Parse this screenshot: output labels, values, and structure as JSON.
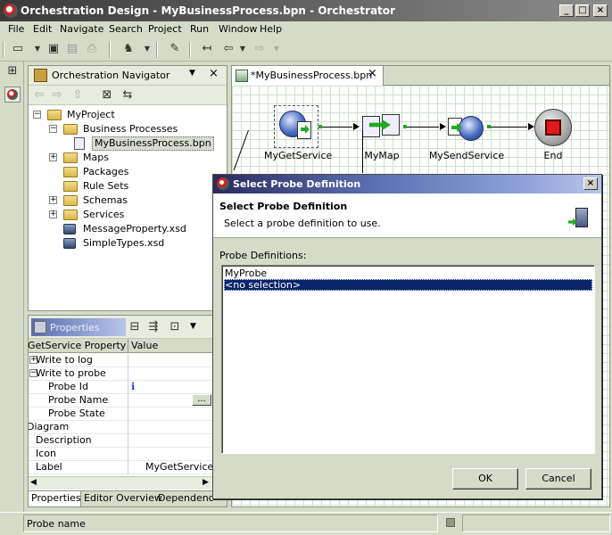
{
  "window": {
    "title": "Orchestration Design - MyBusinessProcess.bpn - Orchestrator",
    "min_glyph": "_",
    "max_glyph": "□",
    "close_glyph": "×"
  },
  "menu": [
    "File",
    "Edit",
    "Navigate",
    "Search",
    "Project",
    "Run",
    "Window",
    "Help"
  ],
  "navigator": {
    "title": "Orchestration Navigator",
    "tree": [
      {
        "label": "MyProject",
        "level": 0,
        "expander": "−",
        "icon": "folder"
      },
      {
        "label": "Business Processes",
        "level": 1,
        "expander": "−",
        "icon": "folder"
      },
      {
        "label": "MyBusinessProcess.bpn",
        "level": 2,
        "expander": "",
        "icon": "bpn-file",
        "selected": true
      },
      {
        "label": "Maps",
        "level": 1,
        "expander": "+",
        "icon": "folder"
      },
      {
        "label": "Packages",
        "level": 1,
        "expander": "",
        "icon": "folder"
      },
      {
        "label": "Rule Sets",
        "level": 1,
        "expander": "",
        "icon": "folder"
      },
      {
        "label": "Schemas",
        "level": 1,
        "expander": "+",
        "icon": "folder"
      },
      {
        "label": "Services",
        "level": 1,
        "expander": "+",
        "icon": "folder"
      },
      {
        "label": "MessageProperty.xsd",
        "level": 1,
        "expander": "",
        "icon": "xsd-file"
      },
      {
        "label": "SimpleTypes.xsd",
        "level": 1,
        "expander": "",
        "icon": "xsd-file"
      }
    ]
  },
  "properties": {
    "title": "Properties",
    "col_property": "GetService Property",
    "col_value": "Value",
    "rows": [
      {
        "key": "Write to log",
        "value": "",
        "indent": 1,
        "expander": "+"
      },
      {
        "key": "Write to probe",
        "value": "",
        "indent": 1,
        "expander": "−"
      },
      {
        "key": "Probe Id",
        "value": "ℹ",
        "indent": 2,
        "expander": ""
      },
      {
        "key": "Probe Name",
        "value": "",
        "indent": 2,
        "expander": "",
        "has_button": true
      },
      {
        "key": "Probe State",
        "value": "",
        "indent": 2,
        "expander": ""
      },
      {
        "key": "Diagram",
        "value": "",
        "indent": 0,
        "expander": ""
      },
      {
        "key": "Description",
        "value": "",
        "indent": 1,
        "expander": ""
      },
      {
        "key": "Icon",
        "value": "",
        "indent": 1,
        "expander": ""
      },
      {
        "key": "Label",
        "value": "MyGetService",
        "indent": 1,
        "expander": ""
      }
    ],
    "ellipsis": "...",
    "tabs": [
      "Properties",
      "Editor Overview",
      "Dependencies"
    ]
  },
  "editor": {
    "tab_label": "*MyBusinessProcess.bpn",
    "nodes": [
      "MyGetService",
      "MyMap",
      "MySendService",
      "End"
    ]
  },
  "dialog": {
    "title": "Select Probe Definition",
    "heading": "Select Probe Definition",
    "subtitle": "Select a probe definition to use.",
    "list_label": "Probe Definitions:",
    "items": [
      {
        "label": "MyProbe",
        "selected": false
      },
      {
        "label": "<no selection>",
        "selected": true
      }
    ],
    "ok_label": "OK",
    "cancel_label": "Cancel",
    "close_glyph": "×"
  },
  "status": {
    "text": "Probe name"
  },
  "colors": {
    "selection": "#0a246a",
    "accent_red": "#e01818",
    "chrome": "#d4dcc9"
  }
}
